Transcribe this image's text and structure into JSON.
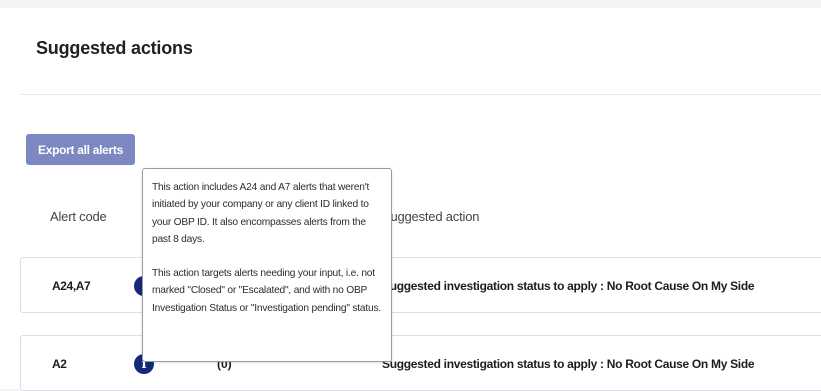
{
  "section": {
    "title": "Suggested actions",
    "export_label": "Export all alerts"
  },
  "table": {
    "headers": {
      "alert_code": "Alert code",
      "suggested_action": "Suggested action"
    },
    "rows": [
      {
        "code": "A24,A7",
        "icon": "info-icon",
        "count": "",
        "action": "Suggested investigation status to apply : No Root Cause On My Side"
      },
      {
        "code": "A2",
        "icon": "info-icon",
        "count": "(0)",
        "action": "Suggested investigation status to apply : No Root Cause On My Side"
      }
    ]
  },
  "tooltip": {
    "paragraph1": "This action includes A24 and A7 alerts that weren't initiated by your company or any client ID linked to your OBP ID. It also encompasses alerts from the past 8 days.",
    "paragraph2": "This action targets alerts needing your input, i.e. not marked \"Closed\" or \"Escalated\", and with no OBP Investigation Status or \"Investigation pending\" status."
  },
  "colors": {
    "accent_button": "#7d88c2",
    "info_icon": "#142a78"
  }
}
